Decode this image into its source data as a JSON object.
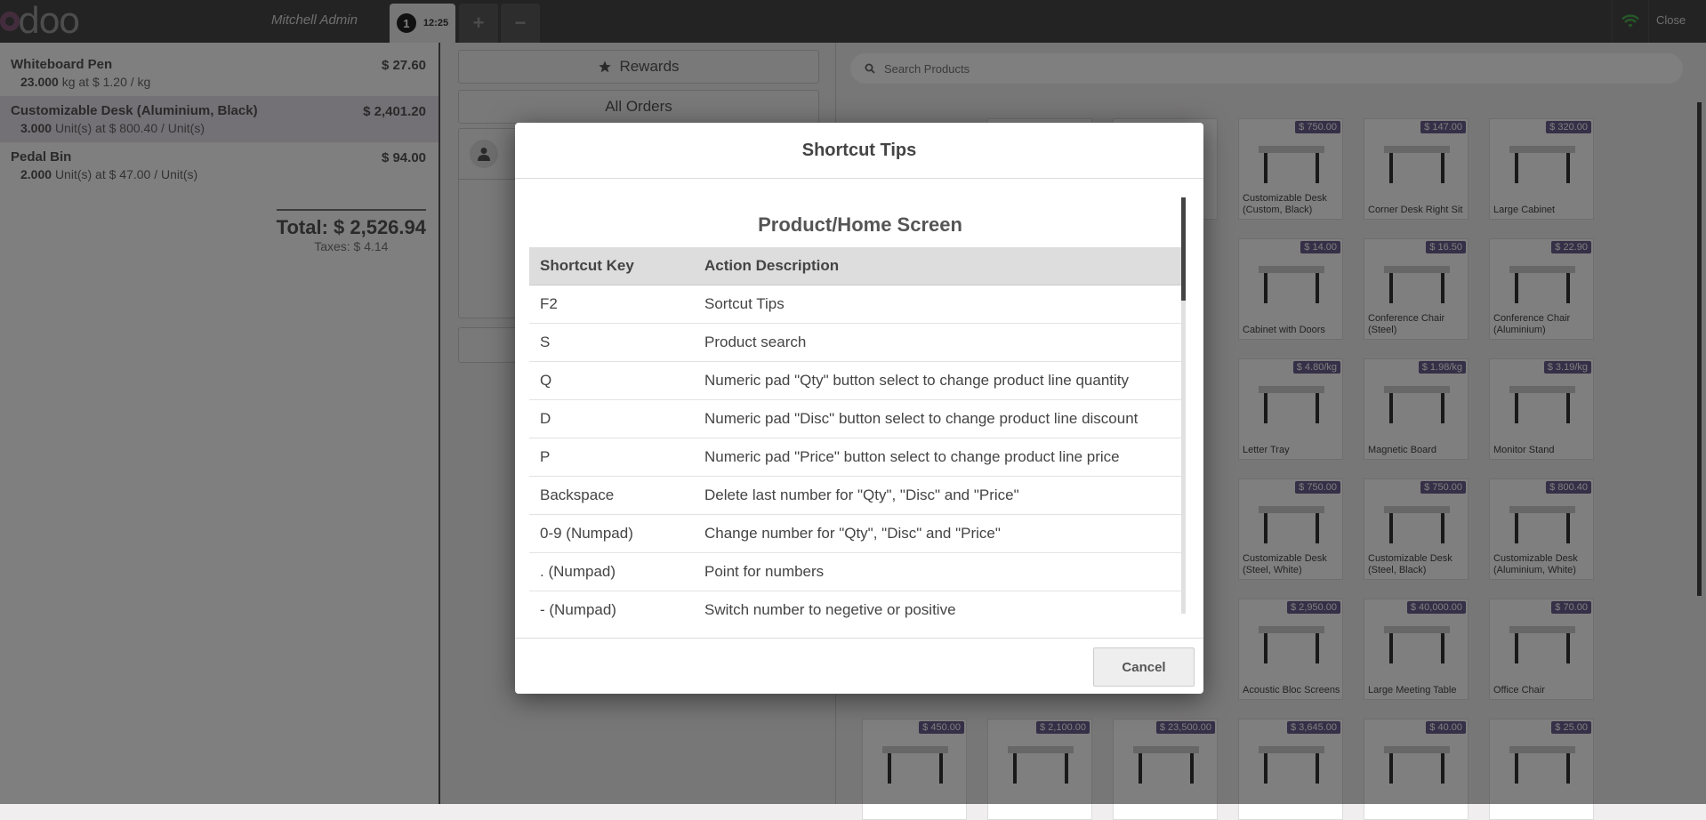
{
  "header": {
    "logo_text": "odoo",
    "user": "Mitchell Admin",
    "order_number": "1",
    "order_time": "12:25",
    "add_order": "+",
    "remove_order": "−",
    "close": "Close"
  },
  "order_lines": [
    {
      "name": "Whiteboard Pen",
      "price": "$ 27.60",
      "qty": "23.000",
      "detail": "kg at $ 1.20 / kg"
    },
    {
      "name": "Customizable Desk (Aluminium, Black)",
      "price": "$ 2,401.20",
      "qty": "3.000",
      "detail": "Unit(s) at $ 800.40 / Unit(s)"
    },
    {
      "name": "Pedal Bin",
      "price": "$ 94.00",
      "qty": "2.000",
      "detail": "Unit(s) at $ 47.00 / Unit(s)"
    }
  ],
  "totals": {
    "total": "Total: $ 2,526.94",
    "taxes": "Taxes: $ 4.14"
  },
  "controls": {
    "rewards": "Rewards",
    "all_orders": "All Orders"
  },
  "search": {
    "placeholder": "Search Products"
  },
  "products": [
    {
      "price": "",
      "label": ""
    },
    {
      "price": "",
      "label": ""
    },
    {
      "price": "$ 750.00",
      "label": "Customizable Desk (Custom, Black)"
    },
    {
      "price": "$ 147.00",
      "label": "Corner Desk Right Sit"
    },
    {
      "price": "$ 320.00",
      "label": "Large Cabinet"
    },
    {
      "price": "$ 14.00",
      "label": "Cabinet with Doors"
    },
    {
      "price": "$ 16.50",
      "label": "Conference Chair (Steel)"
    },
    {
      "price": "$ 22.90",
      "label": "Conference Chair (Aluminium)"
    },
    {
      "price": "$ 4.80/kg",
      "label": "Letter Tray"
    },
    {
      "price": "$ 1.98/kg",
      "label": "Magnetic Board"
    },
    {
      "price": "$ 3.19/kg",
      "label": "Monitor Stand"
    },
    {
      "price": "$ 750.00",
      "label": "Customizable Desk (Steel, White)"
    },
    {
      "price": "$ 750.00",
      "label": "Customizable Desk (Steel, Black)"
    },
    {
      "price": "$ 800.40",
      "label": "Customizable Desk (Aluminium, White)"
    },
    {
      "price": "$ 2,950.00",
      "label": "Acoustic Bloc Screens"
    },
    {
      "price": "$ 40,000.00",
      "label": "Large Meeting Table"
    },
    {
      "price": "$ 70.00",
      "label": "Office Chair"
    },
    {
      "price": "$ 450.00",
      "label": ""
    },
    {
      "price": "$ 2,100.00",
      "label": ""
    },
    {
      "price": "$ 23,500.00",
      "label": ""
    },
    {
      "price": "$ 3,645.00",
      "label": ""
    },
    {
      "price": "$ 40.00",
      "label": ""
    },
    {
      "price": "$ 25.00",
      "label": ""
    }
  ],
  "dialog": {
    "title": "Shortcut Tips",
    "section": "Product/Home Screen",
    "col_key": "Shortcut Key",
    "col_desc": "Action Description",
    "rows": [
      {
        "key": "F2",
        "desc": "Sortcut Tips"
      },
      {
        "key": "S",
        "desc": "Product search"
      },
      {
        "key": "Q",
        "desc": "Numeric pad \"Qty\" button select to change product line quantity"
      },
      {
        "key": "D",
        "desc": "Numeric pad \"Disc\" button select to change product line discount"
      },
      {
        "key": "P",
        "desc": "Numeric pad \"Price\" button select to change product line price"
      },
      {
        "key": "Backspace",
        "desc": "Delete last number for \"Qty\", \"Disc\" and \"Price\""
      },
      {
        "key": "0-9 (Numpad)",
        "desc": "Change number for \"Qty\", \"Disc\" and \"Price\""
      },
      {
        "key": ". (Numpad)",
        "desc": "Point for numbers"
      },
      {
        "key": "- (Numpad)",
        "desc": "Switch number to negetive or positive"
      }
    ],
    "cancel": "Cancel"
  },
  "colors": {
    "accent": "#6b5f8f",
    "topbar": "#464646",
    "wifi": "#4caf50"
  }
}
